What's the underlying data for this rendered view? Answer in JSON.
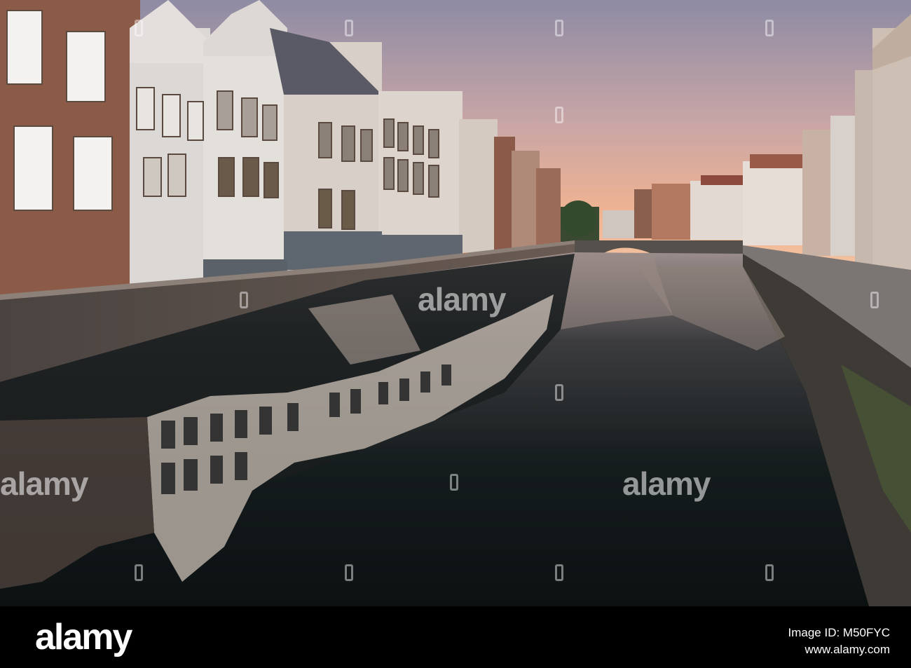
{
  "image": {
    "subject": "canal-at-dusk-scene",
    "colors": {
      "sky_top": "#8d8aa3",
      "sky_horizon": "#f2b394",
      "water_dark": "#0f1516",
      "brick": "#7a5a4a",
      "render_white": "#d9d3cc"
    }
  },
  "watermarks": {
    "center": "alamy",
    "left": "alamy",
    "right": "alamy"
  },
  "footer": {
    "brand": "alamy",
    "image_id": "Image ID: M50FYC",
    "url": "www.alamy.com"
  }
}
